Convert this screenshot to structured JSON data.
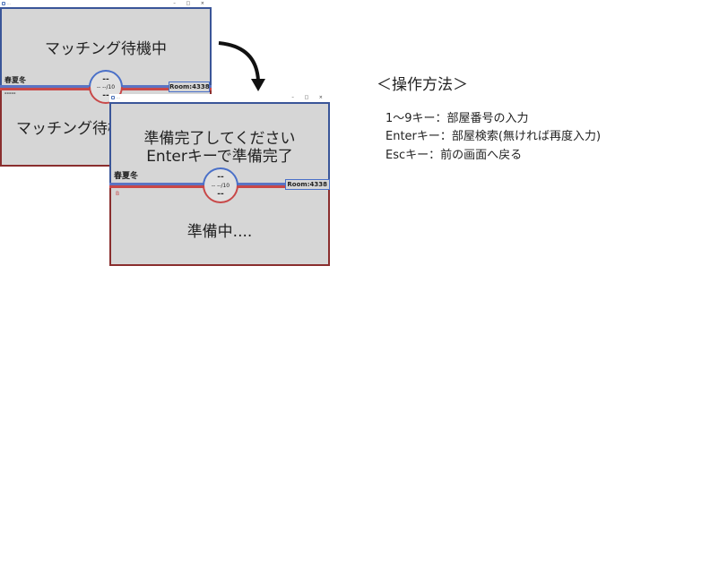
{
  "window_back": {
    "title": "...",
    "controls": "– □ ×",
    "top_message": "マッチング待機中",
    "bottom_message": "マッチング待機中",
    "player_top": "春夏冬",
    "player_bottom": "-----",
    "circle_top": "--",
    "circle_mid": "-- --/10",
    "circle_bot": "--",
    "room": "Room:4338"
  },
  "window_front": {
    "title": "...",
    "controls": "– □ ×",
    "top_message_line1": "準備完了してください",
    "top_message_line2": "Enterキーで準備完了",
    "bottom_message": "準備中....",
    "player_top": "春夏冬",
    "player_bottom": "B",
    "circle_top": "--",
    "circle_mid": "-- --/10",
    "circle_bot": "--",
    "room": "Room:4338"
  },
  "instructions": {
    "heading": "＜操作方法＞",
    "lines": [
      "1～9キー：部屋番号の入力",
      "Enterキー：部屋検索(無ければ再度入力)",
      "Escキー：前の画面へ戻る"
    ]
  },
  "colors": {
    "top_border": "#3a5598",
    "bottom_border": "#8a2e2e",
    "panel_bg": "#d6d6d6",
    "blue_accent": "#4a70c8",
    "red_accent": "#c84848"
  },
  "icons": [
    "app-icon",
    "arrow-down-icon"
  ]
}
